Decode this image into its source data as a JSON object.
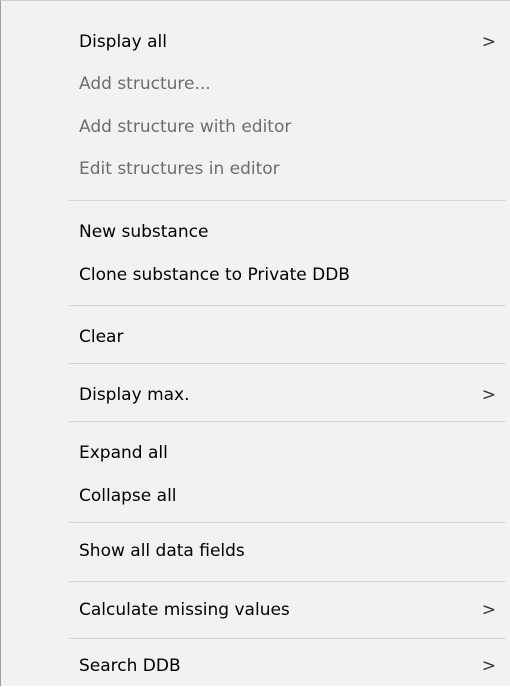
{
  "menu": {
    "items": [
      {
        "label": "Display all",
        "submenu_glyph": ">"
      },
      {
        "label": "Add structure..."
      },
      {
        "label": "Add structure with editor"
      },
      {
        "label": "Edit structures in editor"
      },
      {
        "label": "New substance"
      },
      {
        "label": "Clone substance to Private DDB"
      },
      {
        "label": "Clear"
      },
      {
        "label": "Display max.",
        "submenu_glyph": ">"
      },
      {
        "label": "Expand all"
      },
      {
        "label": "Collapse all"
      },
      {
        "label": "Show all data fields"
      },
      {
        "label": "Calculate missing values",
        "submenu_glyph": ">"
      },
      {
        "label": "Search DDB",
        "submenu_glyph": ">"
      }
    ]
  },
  "colors": {
    "menu_background": "#f2f2f2",
    "separator": "#d7d7d7",
    "enabled_text": "#000000",
    "disabled_text": "#6d6d6d"
  }
}
